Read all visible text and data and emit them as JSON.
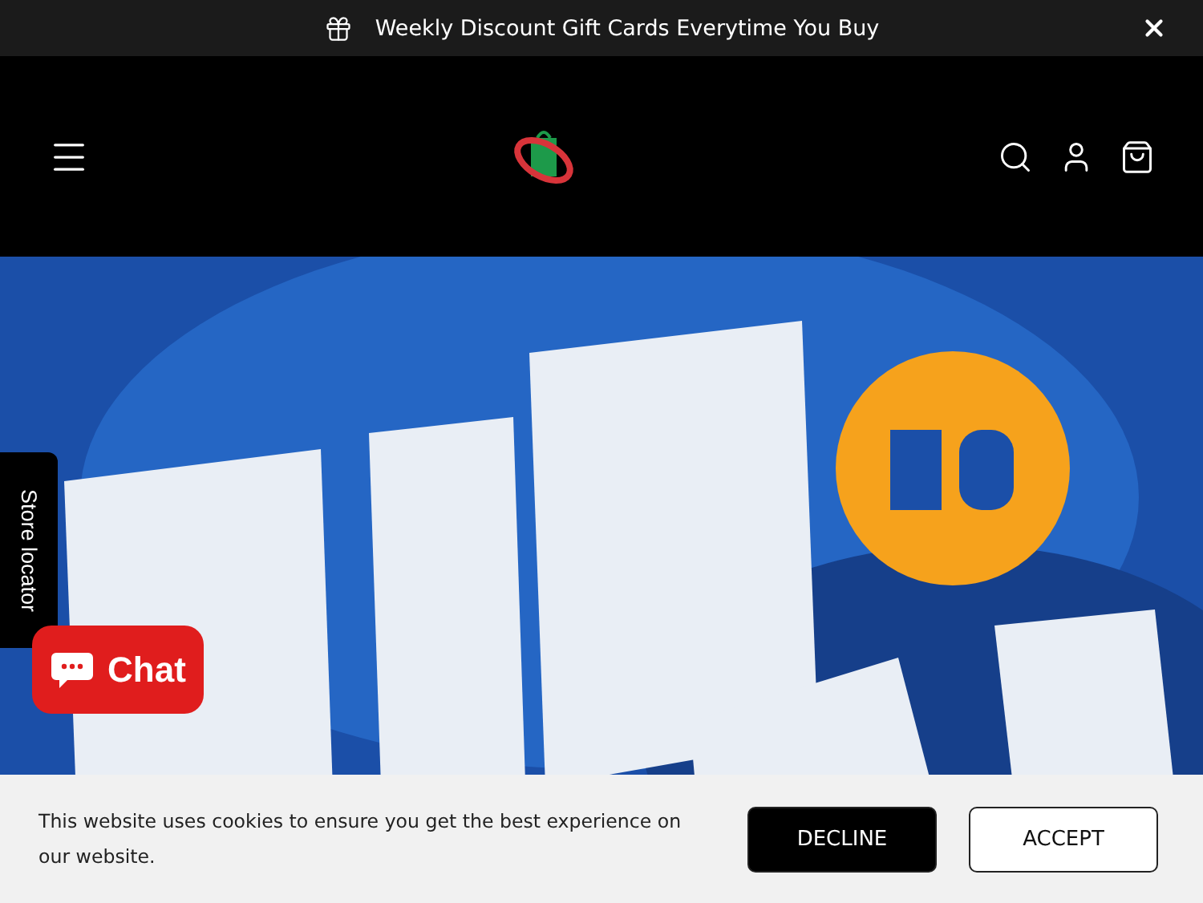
{
  "announcement": {
    "text": "Weekly Discount Gift Cards Everytime You Buy"
  },
  "store_locator": {
    "label": "Store locator"
  },
  "chat": {
    "label": "Chat"
  },
  "cookie_banner": {
    "message": "This website uses cookies to ensure you get the best experience on our website.",
    "buttons": [
      {
        "label": "DECLINE",
        "kind": "dark"
      },
      {
        "label": "ACCEPT",
        "kind": "light"
      }
    ]
  }
}
